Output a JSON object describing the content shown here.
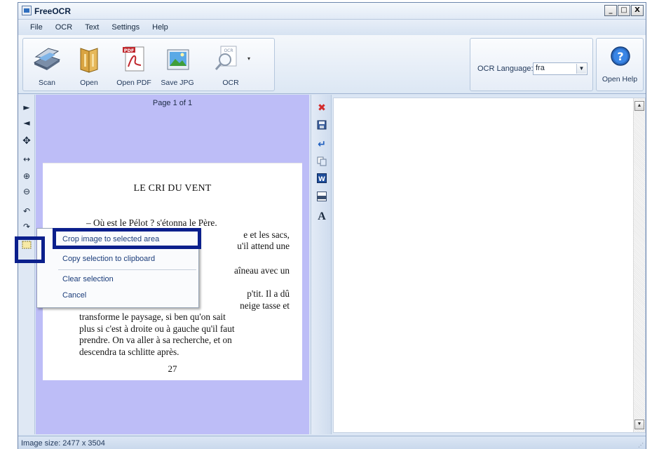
{
  "window": {
    "title": "FreeOCR"
  },
  "title_buttons": {
    "minimize": "_",
    "maximize": "□",
    "close": "X"
  },
  "menu": [
    "File",
    "OCR",
    "Text",
    "Settings",
    "Help"
  ],
  "toolbar": {
    "scan": "Scan",
    "open": "Open",
    "open_pdf": "Open PDF",
    "pdf_badge": "PDF",
    "save_jpg": "Save JPG",
    "ocr": "OCR",
    "ocr_badge": "OCR",
    "ocr_language_label": "OCR Language:",
    "ocr_language_value": "fra",
    "open_help": "Open Help"
  },
  "image_panel": {
    "page_label": "Page 1 of 1",
    "document": {
      "title": "LE CRI DU VENT",
      "lines_top": [
        "– Où est le Pélot ? s'étonna le Père.",
        "e et les sacs,",
        "u'il attend une"
      ],
      "line_mid": "aîneau avec un",
      "lines_bottom": [
        "p'tit. Il a dû",
        "neige tasse et",
        "transforme le paysage, si ben qu'on sait",
        "plus si c'est à droite ou à gauche qu'il faut",
        "prendre. On va aller à sa recherche, et on",
        "descendra ta schlitte après."
      ],
      "page_number": "27"
    }
  },
  "middle_toolbar": {
    "font_glyph": "A"
  },
  "context_menu": {
    "items": [
      "Crop image to selected area",
      "Copy selection to clipboard",
      "Clear selection",
      "Cancel"
    ]
  },
  "status": {
    "image_size": "Image size:  2477 x 3504"
  },
  "colors": {
    "highlight": "#0b1f8c",
    "image_bg": "#bdbdf7",
    "chrome": "#dbe6f4"
  }
}
